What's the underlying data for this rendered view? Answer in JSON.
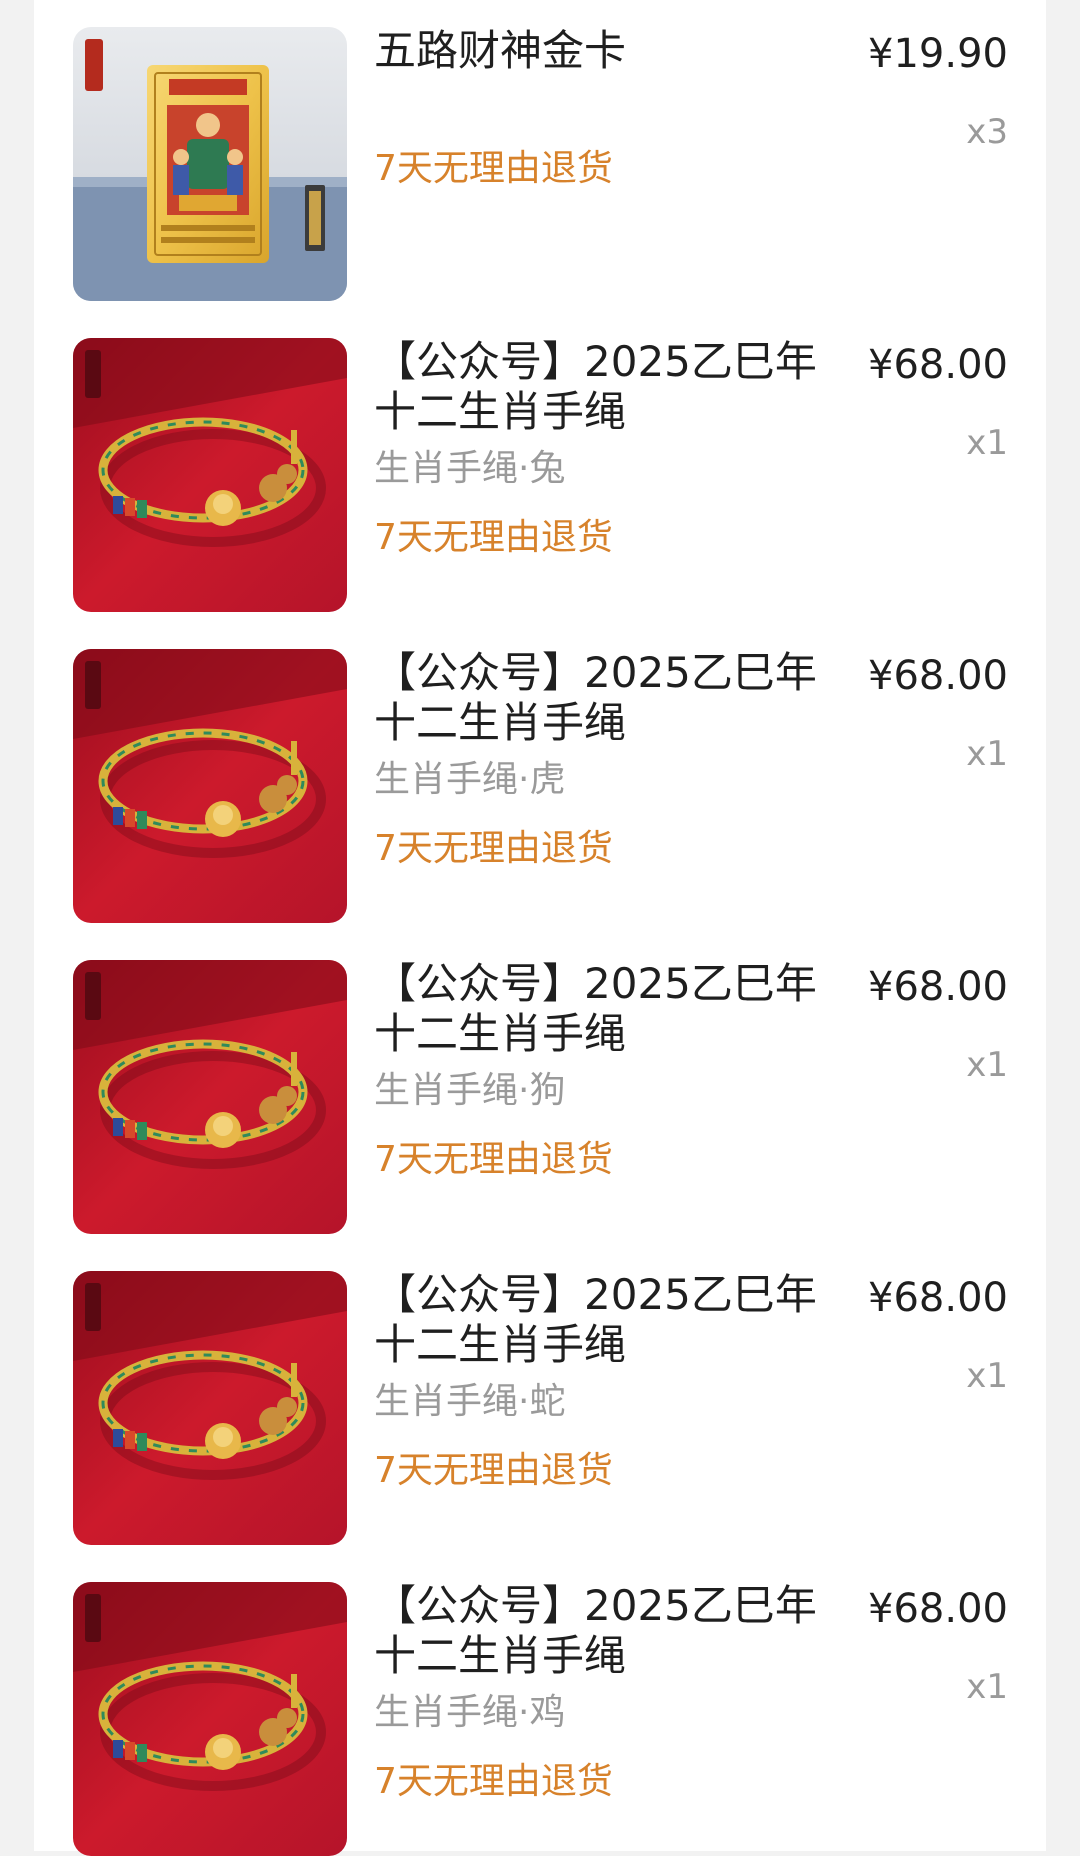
{
  "items": [
    {
      "title": "五路财神金卡",
      "variant": "",
      "badge": "7天无理由退货",
      "price": "¥19.90",
      "qty": "x3",
      "image": "gold-card-image"
    },
    {
      "title": "【公众号】2025乙巳年\n十二生肖手绳",
      "variant": "生肖手绳·兔",
      "badge": "7天无理由退货",
      "price": "¥68.00",
      "qty": "x1",
      "image": "bracelet-image"
    },
    {
      "title": "【公众号】2025乙巳年\n十二生肖手绳",
      "variant": "生肖手绳·虎",
      "badge": "7天无理由退货",
      "price": "¥68.00",
      "qty": "x1",
      "image": "bracelet-image"
    },
    {
      "title": "【公众号】2025乙巳年\n十二生肖手绳",
      "variant": "生肖手绳·狗",
      "badge": "7天无理由退货",
      "price": "¥68.00",
      "qty": "x1",
      "image": "bracelet-image"
    },
    {
      "title": "【公众号】2025乙巳年\n十二生肖手绳",
      "variant": "生肖手绳·蛇",
      "badge": "7天无理由退货",
      "price": "¥68.00",
      "qty": "x1",
      "image": "bracelet-image"
    },
    {
      "title": "【公众号】2025乙巳年\n十二生肖手绳",
      "variant": "生肖手绳·鸡",
      "badge": "7天无理由退货",
      "price": "¥68.00",
      "qty": "x1",
      "image": "bracelet-image"
    }
  ],
  "colors": {
    "accent": "#d7822b",
    "text": "#1f1f1f",
    "muted": "#9a9a9a",
    "background": "#f2f2f2",
    "card": "#ffffff"
  }
}
